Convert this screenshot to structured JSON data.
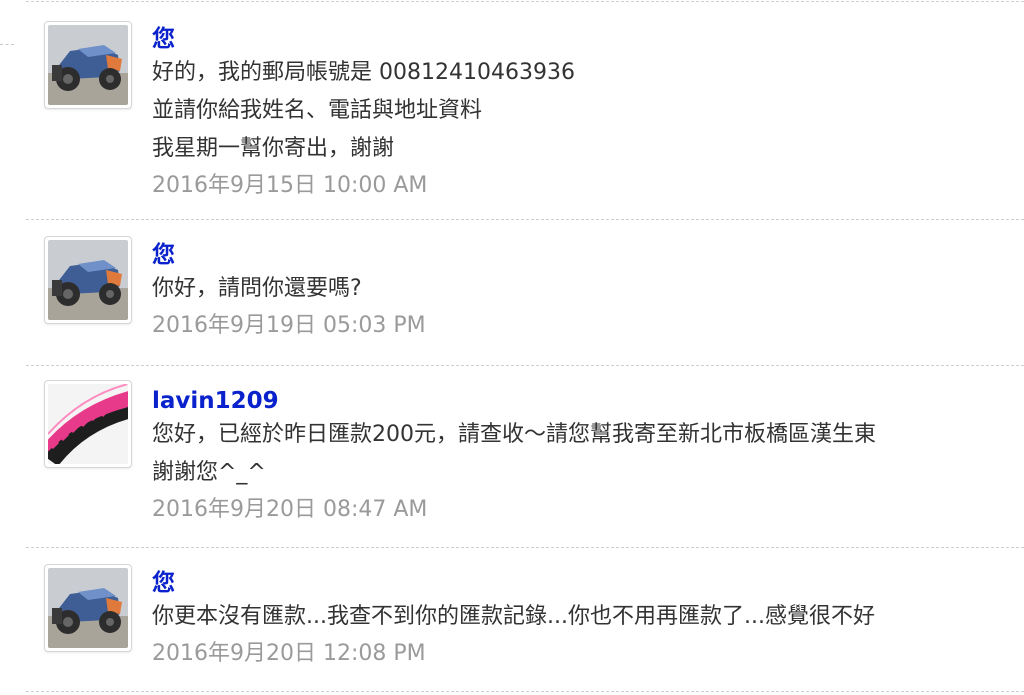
{
  "messages": [
    {
      "sender": "您",
      "avatar": "rc-car-avatar",
      "lines": [
        "好的，我的郵局帳號是 00812410463936",
        "並請你給我姓名、電話與地址資料",
        "我星期一幫你寄出，謝謝"
      ],
      "time": "2016年9月15日 10:00 AM"
    },
    {
      "sender": "您",
      "avatar": "rc-car-avatar",
      "lines": [
        "你好，請問你還要嗎?"
      ],
      "time": "2016年9月19日 05:03 PM"
    },
    {
      "sender": "lavin1209",
      "avatar": "pink-tire-avatar",
      "lines": [
        "您好，已經於昨日匯款200元，請查收～請您幫我寄至新北市板橋區漢生東",
        "謝謝您^_^"
      ],
      "time": "2016年9月20日 08:47 AM"
    },
    {
      "sender": "您",
      "avatar": "rc-car-avatar",
      "lines": [
        "你更本沒有匯款...我查不到你的匯款記錄...你也不用再匯款了...感覺很不好"
      ],
      "time": "2016年9月20日 12:08 PM"
    }
  ],
  "colors": {
    "sender": "#0a22cc",
    "text": "#333333",
    "time": "#9a9a9a",
    "divider": "#cfcfcf"
  }
}
